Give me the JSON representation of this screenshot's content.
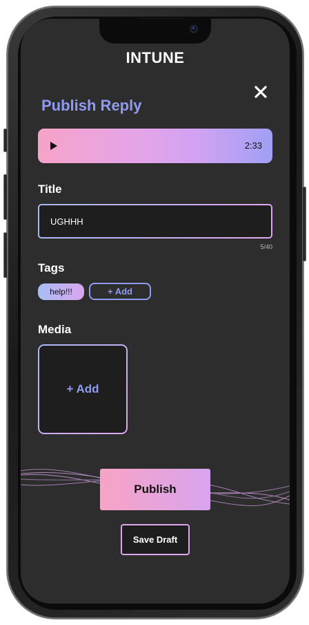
{
  "app": {
    "title": "INTUNE"
  },
  "header": {
    "heading": "Publish Reply",
    "close_icon": "close-icon"
  },
  "audio_player": {
    "duration": "2:33",
    "play_icon": "play-icon"
  },
  "title_section": {
    "label": "Title",
    "value": "UGHHH",
    "counter": "5/40"
  },
  "tags_section": {
    "label": "Tags",
    "tags": [
      "help!!!"
    ],
    "add_label": "+ Add"
  },
  "media_section": {
    "label": "Media",
    "add_label": "+ Add"
  },
  "actions": {
    "publish_label": "Publish",
    "save_draft_label": "Save Draft"
  },
  "colors": {
    "background": "#2d2d2d",
    "accent": "#8f9bf0",
    "gradient_pink": "#f7a3c8",
    "gradient_purple": "#cfa2f3",
    "gradient_blue": "#9fa0f4"
  }
}
